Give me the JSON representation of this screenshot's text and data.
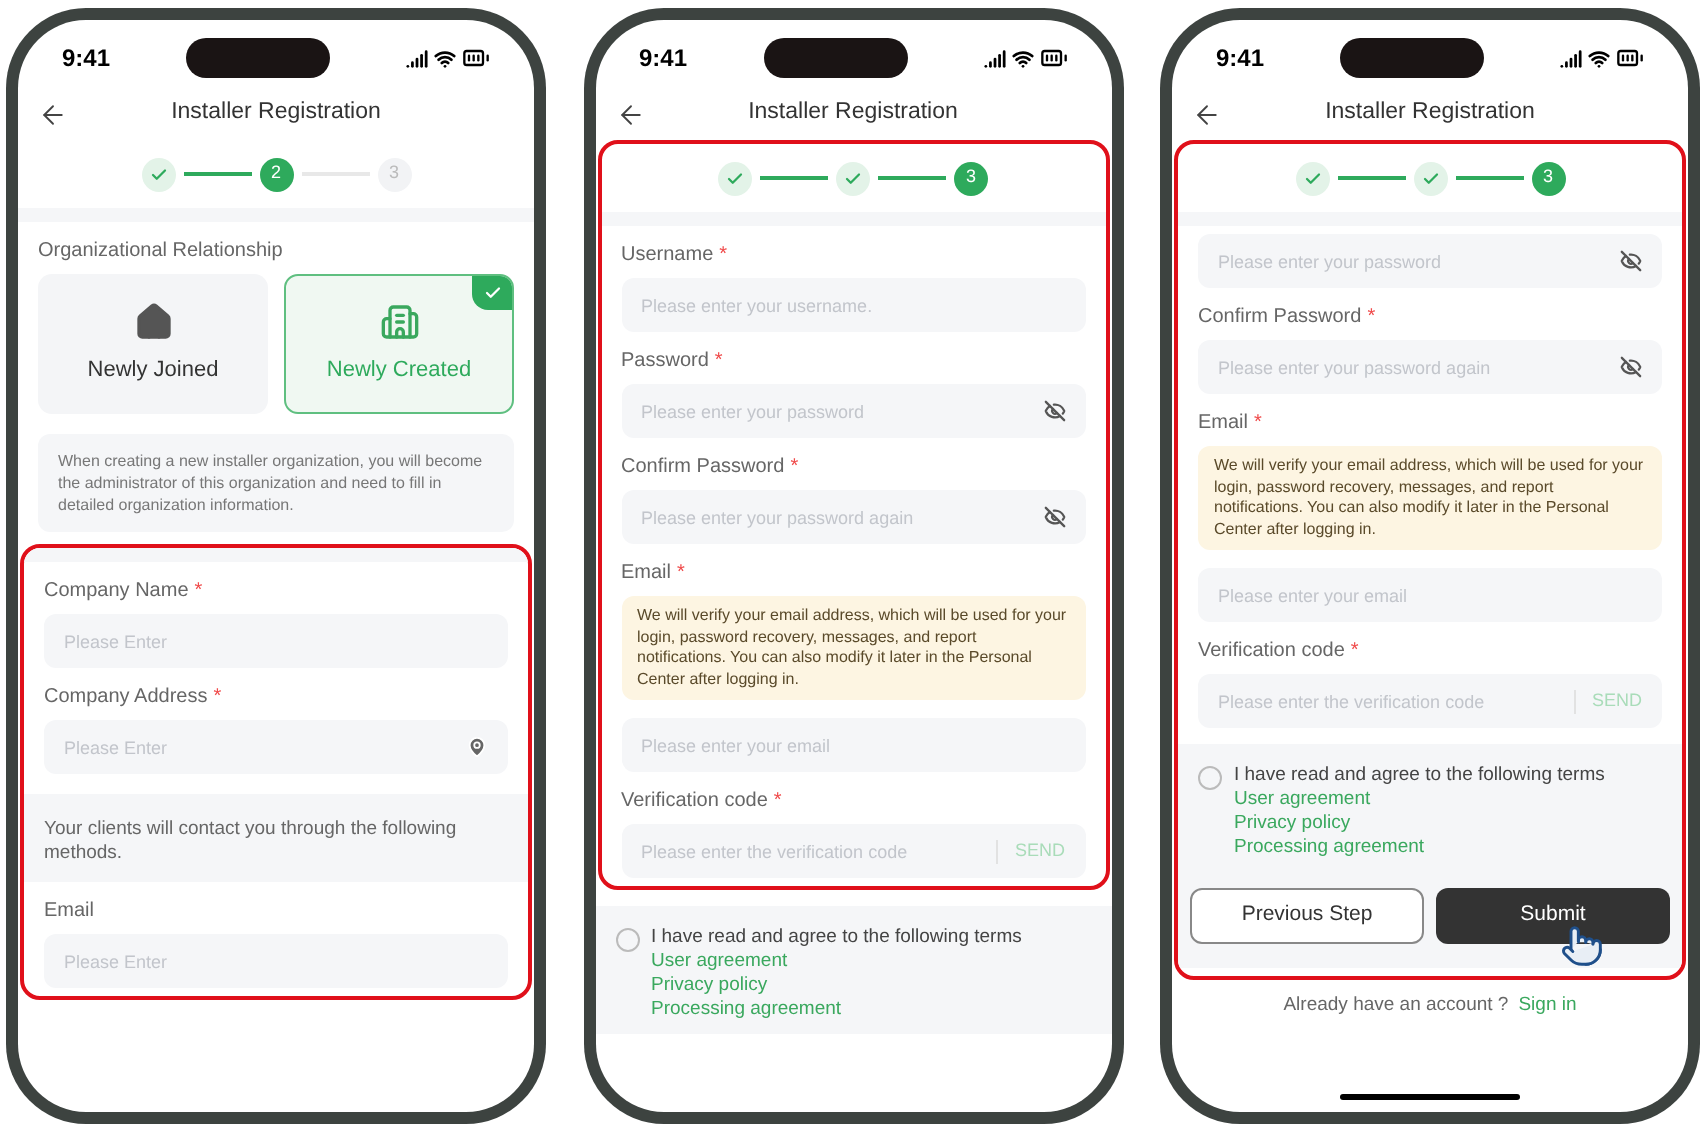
{
  "phones": [
    {
      "time": "9:41",
      "title": "Installer Registration",
      "sections": [
        {
          "blocks": [
            {
              "kind": "steps",
              "steps": [
                {
                  "kind": "done"
                },
                {
                  "kind": "current",
                  "number": "2"
                },
                {
                  "kind": "pending",
                  "number": "3"
                }
              ]
            },
            {
              "kind": "gap"
            },
            {
              "kind": "label",
              "text": "Organizational Relationship"
            },
            {
              "kind": "choices",
              "options": [
                {
                  "label": "Newly Joined",
                  "selected": false
                },
                {
                  "label": "Newly Created",
                  "selected": true
                }
              ]
            },
            {
              "kind": "note",
              "text": "When creating a new installer organization, you will become the administrator of this organization and need to fill in detailed organization information."
            }
          ]
        },
        {
          "highlighted": true,
          "blocks": [
            {
              "kind": "gap"
            },
            {
              "kind": "field",
              "label": "Company Name",
              "required_mark": "*",
              "placeholder": "Please Enter"
            },
            {
              "kind": "address_field",
              "label": "Company Address",
              "required_mark": "*",
              "placeholder": "Please Enter"
            },
            {
              "kind": "band",
              "text": "Your clients will contact you through the following methods."
            },
            {
              "kind": "field",
              "label": "Email",
              "placeholder": "Please Enter"
            }
          ]
        }
      ]
    },
    {
      "time": "9:41",
      "title": "Installer Registration",
      "sections": [
        {
          "highlighted": true,
          "blocks": [
            {
              "kind": "steps",
              "steps": [
                {
                  "kind": "done"
                },
                {
                  "kind": "done"
                },
                {
                  "kind": "current",
                  "number": "3"
                }
              ]
            },
            {
              "kind": "gap"
            },
            {
              "kind": "field",
              "label": "Username",
              "required_mark": "*",
              "placeholder": "Please enter your username."
            },
            {
              "kind": "password_field",
              "label": "Password",
              "required_mark": "*",
              "placeholder": "Please enter your password"
            },
            {
              "kind": "password_field",
              "label": "Confirm Password",
              "required_mark": "*",
              "placeholder": "Please enter your password again"
            },
            {
              "kind": "label",
              "text": "Email",
              "required_mark": "*"
            },
            {
              "kind": "notice",
              "text": "We will verify your email address, which will be used for your login, password recovery, messages, and report notifications. You can also modify it later in the Personal Center after logging in."
            },
            {
              "kind": "field",
              "placeholder": "Please enter your email"
            },
            {
              "kind": "code_field",
              "label": "Verification code",
              "required_mark": "*",
              "placeholder": "Please enter the verification code",
              "action": "SEND"
            }
          ]
        },
        {
          "blocks": [
            {
              "kind": "terms",
              "checked": false,
              "text": "I have read and agree to the following terms",
              "links": [
                "User agreement",
                "Privacy policy",
                "Processing agreement"
              ]
            }
          ]
        }
      ]
    },
    {
      "time": "9:41",
      "title": "Installer Registration",
      "sections": [
        {
          "highlighted": true,
          "blocks": [
            {
              "kind": "steps",
              "steps": [
                {
                  "kind": "done"
                },
                {
                  "kind": "done"
                },
                {
                  "kind": "current",
                  "number": "3"
                }
              ]
            },
            {
              "kind": "gap"
            },
            {
              "kind": "password_field",
              "placeholder": "Please enter your password"
            },
            {
              "kind": "password_field",
              "label": "Confirm Password",
              "required_mark": "*",
              "placeholder": "Please enter your password again"
            },
            {
              "kind": "label",
              "text": "Email",
              "required_mark": "*"
            },
            {
              "kind": "notice",
              "text": "We will verify your email address, which will be used for your login, password recovery, messages, and report notifications. You can also modify it later in the Personal Center after logging in."
            },
            {
              "kind": "field",
              "placeholder": "Please enter your email"
            },
            {
              "kind": "code_field",
              "label": "Verification code",
              "required_mark": "*",
              "placeholder": "Please enter the verification code",
              "action": "SEND"
            },
            {
              "kind": "terms",
              "checked": false,
              "text": "I have read and agree to the following terms",
              "links": [
                "User agreement",
                "Privacy policy",
                "Processing agreement"
              ]
            },
            {
              "kind": "buttons",
              "buttons": [
                {
                  "label": "Previous Step",
                  "kind": "secondary"
                },
                {
                  "label": "Submit",
                  "kind": "primary",
                  "pointer": true
                }
              ]
            }
          ]
        },
        {
          "blocks": [
            {
              "kind": "footer",
              "text": "Already have an account ?",
              "link": "Sign in"
            }
          ]
        }
      ]
    }
  ]
}
